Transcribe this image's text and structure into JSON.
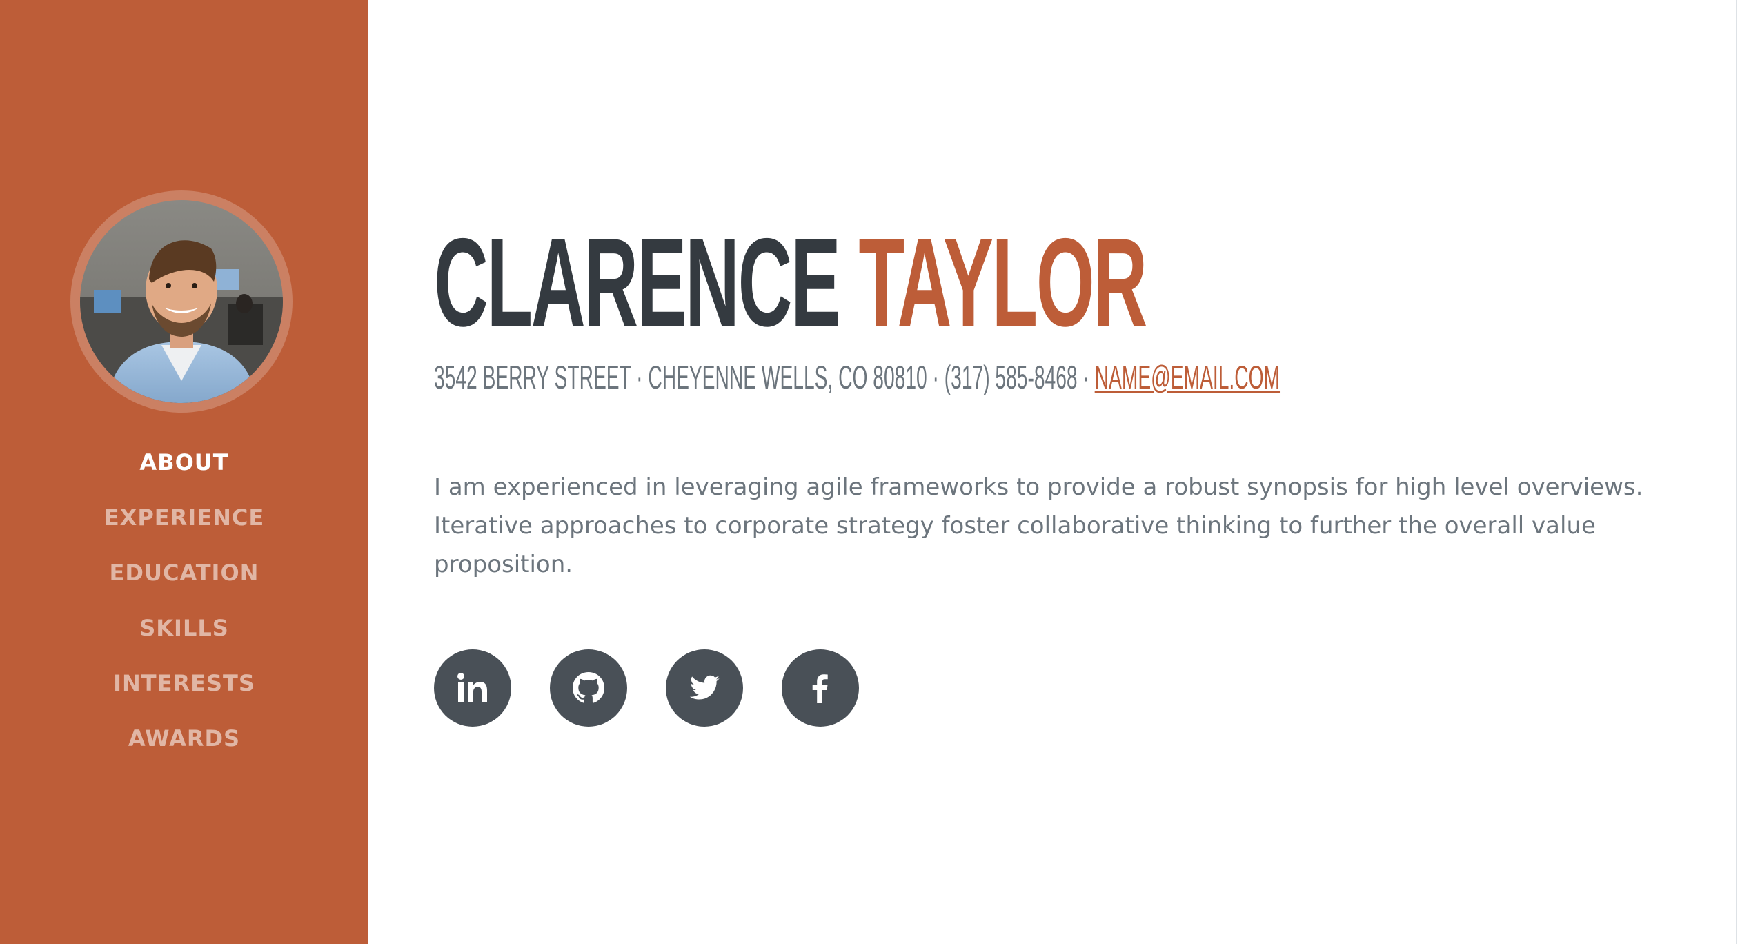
{
  "sidebar": {
    "nav": [
      {
        "label": "ABOUT",
        "active": true
      },
      {
        "label": "EXPERIENCE",
        "active": false
      },
      {
        "label": "EDUCATION",
        "active": false
      },
      {
        "label": "SKILLS",
        "active": false
      },
      {
        "label": "INTERESTS",
        "active": false
      },
      {
        "label": "AWARDS",
        "active": false
      }
    ]
  },
  "about": {
    "first_name": "CLARENCE",
    "last_name": "TAYLOR",
    "address": "3542 BERRY STREET · CHEYENNE WELLS, CO 80810 · (317) 585-8468 · ",
    "email": "NAME@EMAIL.COM",
    "bio": "I am experienced in leveraging agile frameworks to provide a robust synopsis for high level overviews. Iterative approaches to corporate strategy foster collaborative thinking to further the overall value proposition.",
    "socials": [
      {
        "icon": "linkedin-icon"
      },
      {
        "icon": "github-icon"
      },
      {
        "icon": "twitter-icon"
      },
      {
        "icon": "facebook-icon"
      }
    ]
  },
  "colors": {
    "primary": "#bd5d38",
    "dark": "#343a40",
    "muted": "#6c757d",
    "social_bg": "#495057"
  }
}
